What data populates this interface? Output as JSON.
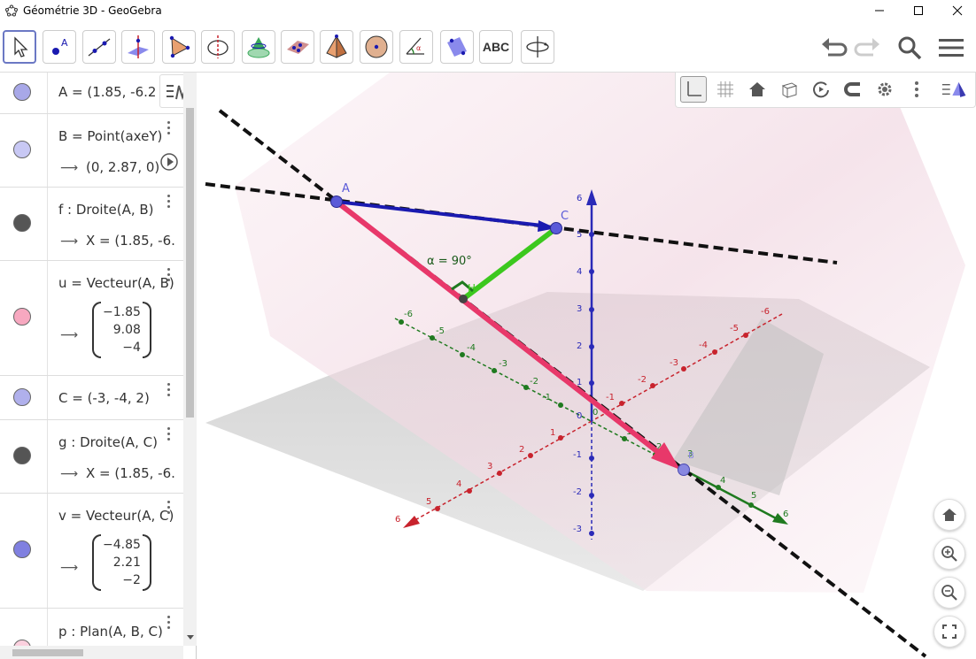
{
  "window": {
    "title": "Géométrie 3D - GeoGebra"
  },
  "toolbar": {
    "tools": [
      {
        "name": "move",
        "icon": "cursor-arrow-icon"
      },
      {
        "name": "point",
        "icon": "point-icon"
      },
      {
        "name": "line",
        "icon": "line-icon"
      },
      {
        "name": "perpendicular-line",
        "icon": "perpendicular-line-icon"
      },
      {
        "name": "polygon",
        "icon": "polygon-icon"
      },
      {
        "name": "circle-axis",
        "icon": "circle-axis-icon"
      },
      {
        "name": "intersect",
        "icon": "intersect-surfaces-icon"
      },
      {
        "name": "plane",
        "icon": "plane-points-icon"
      },
      {
        "name": "pyramid",
        "icon": "pyramid-icon"
      },
      {
        "name": "sphere",
        "icon": "sphere-icon"
      },
      {
        "name": "angle",
        "icon": "angle-icon"
      },
      {
        "name": "reflect",
        "icon": "reflect-plane-icon"
      },
      {
        "name": "text",
        "label": "ABC"
      },
      {
        "name": "rotate-view",
        "icon": "rotate-view-icon"
      }
    ]
  },
  "algebra": {
    "items": [
      {
        "def": "A = (1.85, -6.2",
        "color": "#a8a8e8"
      },
      {
        "def": "B = Point(axeY)",
        "out": "(0, 2.87, 0)",
        "color": "#c8c8f4"
      },
      {
        "def": "f : Droite(A, B)",
        "out": "X = (1.85, -6.",
        "color": "#555555"
      },
      {
        "def": "u = Vecteur(A, B)",
        "vector": [
          "−1.85",
          "9.08",
          "−4"
        ],
        "color": "#f7a8c0"
      },
      {
        "def": "C = (-3, -4, 2)",
        "color": "#b0b0ec"
      },
      {
        "def": "g : Droite(A, C)",
        "out": "X = (1.85, -6.",
        "color": "#555555"
      },
      {
        "def": "v = Vecteur(A, C)",
        "vector": [
          "−4.85",
          "2.21",
          "−2"
        ],
        "color": "#8080e0"
      },
      {
        "def": "p : Plan(A, B, C)",
        "color": "#fbd0de"
      }
    ]
  },
  "graphics": {
    "labels": {
      "A": "A",
      "C": "C",
      "H": "H",
      "B": "B",
      "angle": "α = 90°"
    },
    "axis_ticks": {
      "z": [
        "6",
        "5",
        "4",
        "3",
        "2",
        "1",
        "0",
        "-1",
        "-2",
        "-3"
      ],
      "x": [
        "-6",
        "-5",
        "-4",
        "-3",
        "-2",
        "-1",
        "1",
        "2",
        "3",
        "4",
        "5",
        "6"
      ],
      "y": [
        "-6",
        "-5",
        "-4",
        "-3",
        "-2",
        "-1",
        "0",
        "1",
        "2",
        "3",
        "4",
        "5",
        "6"
      ]
    },
    "colors": {
      "z_axis": "#2a2ab8",
      "x_axis": "#c8232d",
      "y_axis": "#1f7a1f",
      "vector_u": "#e8386a",
      "vector_v": "#1a1ab0",
      "segment_h": "#3cc81e",
      "plane": "#f3d0dc"
    }
  }
}
